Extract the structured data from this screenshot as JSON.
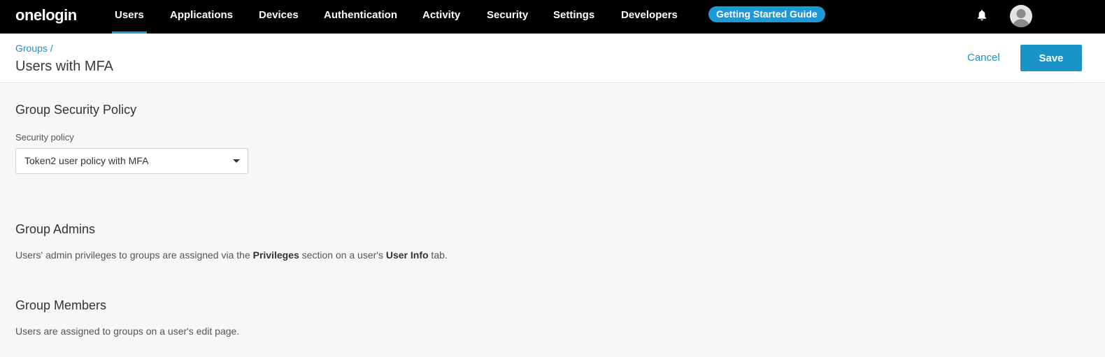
{
  "brand": "onelogin",
  "nav": {
    "items": [
      "Users",
      "Applications",
      "Devices",
      "Authentication",
      "Activity",
      "Security",
      "Settings",
      "Developers"
    ],
    "guide_label": "Getting Started Guide"
  },
  "header": {
    "breadcrumb": "Groups /",
    "title": "Users with MFA",
    "cancel_label": "Cancel",
    "save_label": "Save"
  },
  "security": {
    "title": "Group Security Policy",
    "field_label": "Security policy",
    "selected": "Token2 user policy with MFA"
  },
  "admins": {
    "title": "Group Admins",
    "desc_pre": "Users' admin privileges to groups are assigned via the ",
    "desc_bold1": "Privileges",
    "desc_mid": " section on a user's ",
    "desc_bold2": "User Info",
    "desc_post": " tab."
  },
  "members": {
    "title": "Group Members",
    "desc": "Users are assigned to groups on a user's edit page."
  },
  "colors": {
    "accent": "#1a93c9",
    "nav_bg": "#000000",
    "page_bg": "#f6f7f9"
  },
  "icons": {
    "notifications": "bell-icon",
    "user": "avatar-icon",
    "dropdown": "caret-down-icon"
  }
}
